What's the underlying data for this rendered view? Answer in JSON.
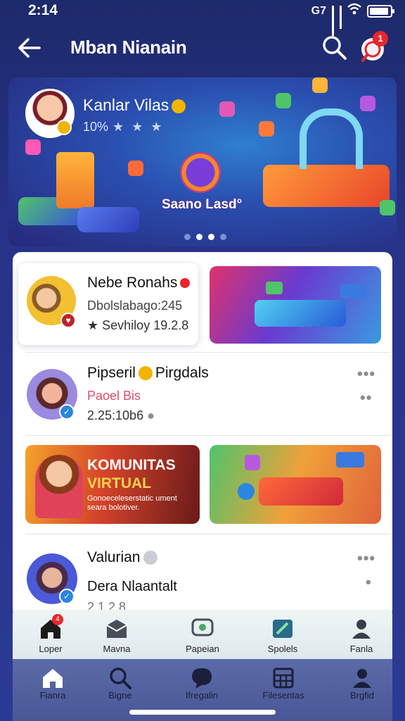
{
  "status_bar": {
    "time": "2:14",
    "network": "G7"
  },
  "app_bar": {
    "title": "Mban Nianain",
    "notification_count": "1"
  },
  "banner": {
    "host_name": "Kanlar Vilas",
    "host_rating": "10%",
    "stars": "★ ★ ★",
    "center_label": "Saano Lasd°",
    "page_count": 4,
    "active_page": 2
  },
  "feed": {
    "item1": {
      "name": "Nebe Ronahs",
      "subtitle": "Dbolslabago:245",
      "meta": "Sevhiloy 19.2.8"
    },
    "item2": {
      "name": "Pipseril",
      "name_suffix": "Pirgdals",
      "subtitle": "Paoel Bis",
      "meta": "2.25:10b6"
    },
    "promo": {
      "title_line1": "KOMUNITAS",
      "title_line2": "VIRTUAL",
      "desc": "Gonoeceleserstatic ument seara bolotiver."
    },
    "item3": {
      "name": "Valurian",
      "subtitle": "Dera Nlaantalt",
      "meta": "2.1.2 8"
    }
  },
  "tabs": [
    {
      "label": "Loper",
      "icon": "home-icon",
      "badge": "4"
    },
    {
      "label": "Mavna",
      "icon": "inbox-icon"
    },
    {
      "label": "Papeian",
      "icon": "chat-icon"
    },
    {
      "label": "Spolels",
      "icon": "edit-icon"
    },
    {
      "label": "Fanla",
      "icon": "profile-icon"
    }
  ],
  "nav": [
    {
      "label": "Fianra",
      "icon": "home-icon"
    },
    {
      "label": "Bigne",
      "icon": "search-icon"
    },
    {
      "label": "Ifregalin",
      "icon": "message-icon"
    },
    {
      "label": "Filesentas",
      "icon": "grid-icon"
    },
    {
      "label": "Brgfid",
      "icon": "profile-icon"
    }
  ],
  "colors": {
    "accent_red": "#e8262c",
    "gold": "#f2b400",
    "background_navy": "#1d2a6b"
  }
}
